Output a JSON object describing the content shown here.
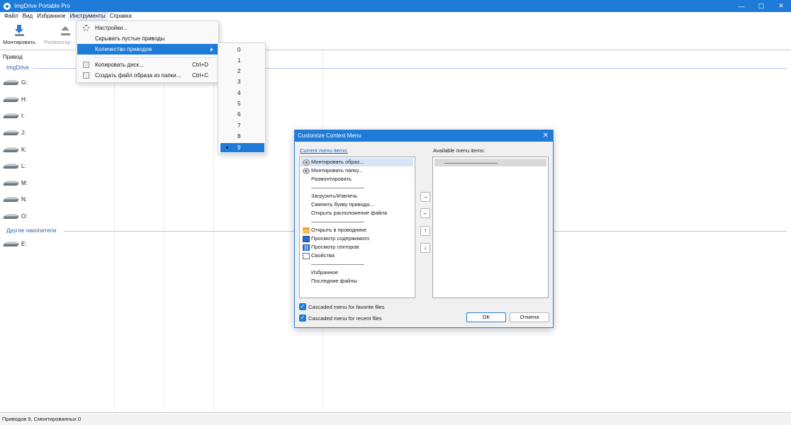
{
  "window": {
    "title": "ImgDrive Portable Pro",
    "controls": [
      "—",
      "▢",
      "✕"
    ]
  },
  "menubar": [
    "Файл",
    "Вид",
    "Избранное",
    "Инструменты",
    "Справка"
  ],
  "toolbar": {
    "mount": "Монтировать",
    "unmount": "Размонтир"
  },
  "list": {
    "column_header": "Привод",
    "group1": "ImgDrive",
    "drives_group1": [
      "G:",
      "H:",
      "I:",
      "J:",
      "K:",
      "L:",
      "M:",
      "N:",
      "O:"
    ],
    "group2": "Другие накопители",
    "drives_group2": [
      "E:"
    ]
  },
  "tools_menu": {
    "settings": "Настройки...",
    "hide_empty": "Скрывать пустые приводы",
    "drive_count": "Количество приводов",
    "copy_disc": "Копировать диск...",
    "copy_disc_sc": "Ctrl+D",
    "create_image": "Создать файл образа из папки...",
    "create_image_sc": "Ctrl+C"
  },
  "drive_count_submenu": {
    "options": [
      "0",
      "1",
      "2",
      "3",
      "4",
      "5",
      "6",
      "7",
      "8",
      "9"
    ],
    "selected": "9"
  },
  "dialog": {
    "title": "Customize Context Menu",
    "close": "✕",
    "current_label": "Current menu items:",
    "available_label": "Available menu items:",
    "current_items": [
      "Монтировать образ...",
      "Монтировать папку...",
      "Размонтировать",
      "——————————",
      "Загрузить/Извлечь",
      "Сменить букву привода...",
      "Открыть расположение файла",
      "——————————",
      "Открыть в проводнике",
      "Просмотр содержимого",
      "Просмотр секторов",
      "Свойства",
      "——————————",
      "Избранное",
      "Последние файлы"
    ],
    "available_items": [
      "——————————"
    ],
    "arrows": [
      "→",
      "←",
      "↑",
      "↓"
    ],
    "cascade_favorites": "Cascaded menu for favorite files",
    "cascade_recent": "Cascaded menu for recent files",
    "checkmark": "✓",
    "ok": "OK",
    "cancel": "Отмена"
  },
  "status": "Приводов 9, Смонтированных 0",
  "colors": {
    "accent": "#1e7bd7",
    "group_header": "#3a5fa8"
  }
}
